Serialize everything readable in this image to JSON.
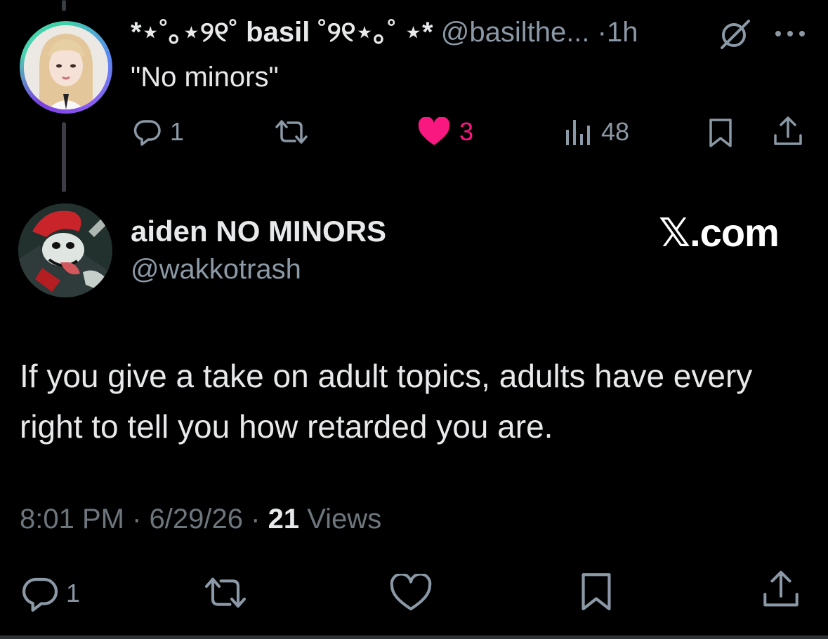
{
  "reply": {
    "display_name": "*⋆˚｡⋆୨୧˚ basil ˚୨୧⋆｡˚ ⋆*",
    "handle": "@basilthe...",
    "separator": "·",
    "time": "1h",
    "text": "\"No minors\"",
    "actions": {
      "replies": "1",
      "likes": "3",
      "views": "48"
    },
    "colors": {
      "like": "#f91880",
      "muted": "#8b98a5"
    }
  },
  "main_tweet": {
    "display_name": "aiden NO MINORS",
    "handle": "@wakkotrash",
    "brand": "𝕏.com",
    "body": "If you give a take on adult topics, adults have every right to tell you how retarded you are.",
    "time": "8:01 PM",
    "date": "6/29/26",
    "separator": "·",
    "views_count": "21",
    "views_label": "Views",
    "actions": {
      "replies": "1"
    }
  },
  "icons": {
    "reply": "reply-bubble-icon",
    "retweet": "retweet-icon",
    "like": "heart-icon",
    "views": "views-chart-icon",
    "bookmark": "bookmark-icon",
    "share": "share-icon",
    "grok": "grok-icon",
    "more": "more-dots-icon"
  }
}
